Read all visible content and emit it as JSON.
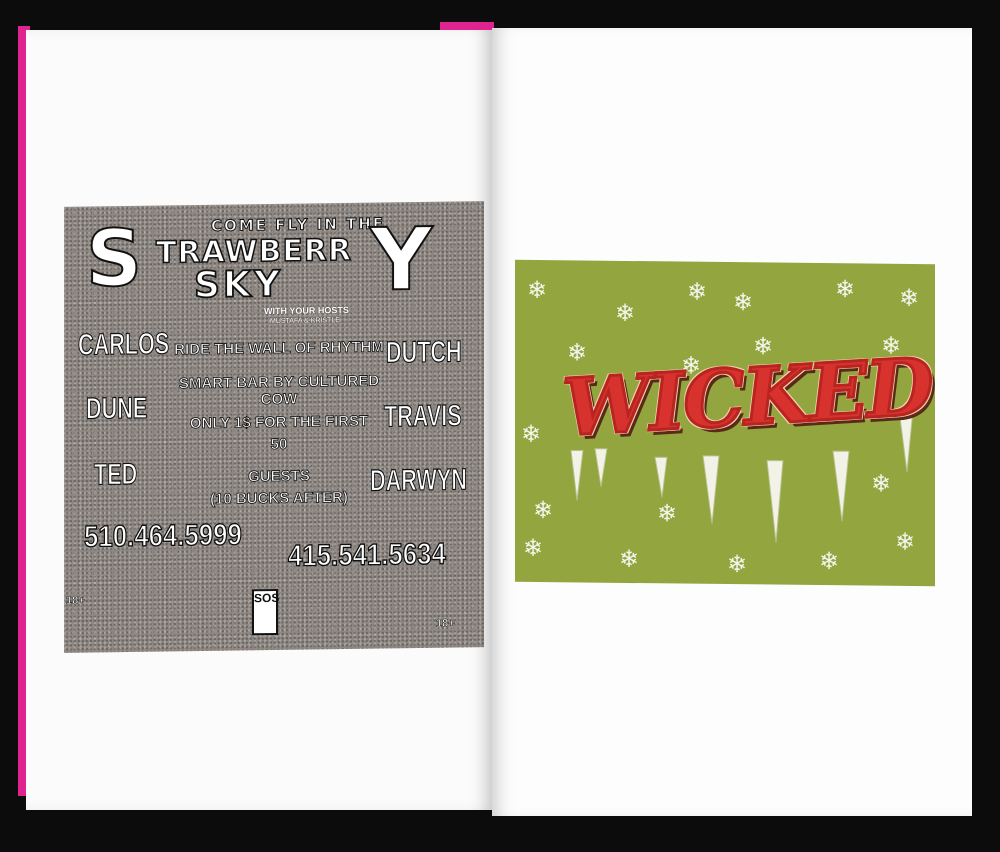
{
  "flyer_left": {
    "come_fly": "COME FLY IN THE",
    "s_letter": "S",
    "strawberr": "TRAWBERR",
    "y_letter": "Y",
    "sky": "SKY",
    "hosts_line": "WITH YOUR HOSTS",
    "hosts_names": "MUSTAFA & KRISTLE",
    "left_names": [
      "CARLOS",
      "DUNE",
      "TED"
    ],
    "right_names": [
      "DUTCH",
      "TRAVIS",
      "DARWYN"
    ],
    "center_lines": [
      "RIDE THE WALL OF RHYTHM",
      "SMART BAR BY CULTURED COW",
      "ONLY 1$ FOR THE FIRST",
      "50",
      "GUESTS",
      "(10 BUCKS AFTER)"
    ],
    "phone_left": "510.464.5999",
    "phone_right": "415.541.5634",
    "age_left": "18+",
    "age_right": "18+",
    "sos_logo": "SOS"
  },
  "flyer_right": {
    "wordmark": "WICKED",
    "background_color": "#93a53e",
    "text_color": "#d8322f",
    "snowflake_icon": "snowflake-icon"
  },
  "book": {
    "edge_color": "#e0248f"
  }
}
